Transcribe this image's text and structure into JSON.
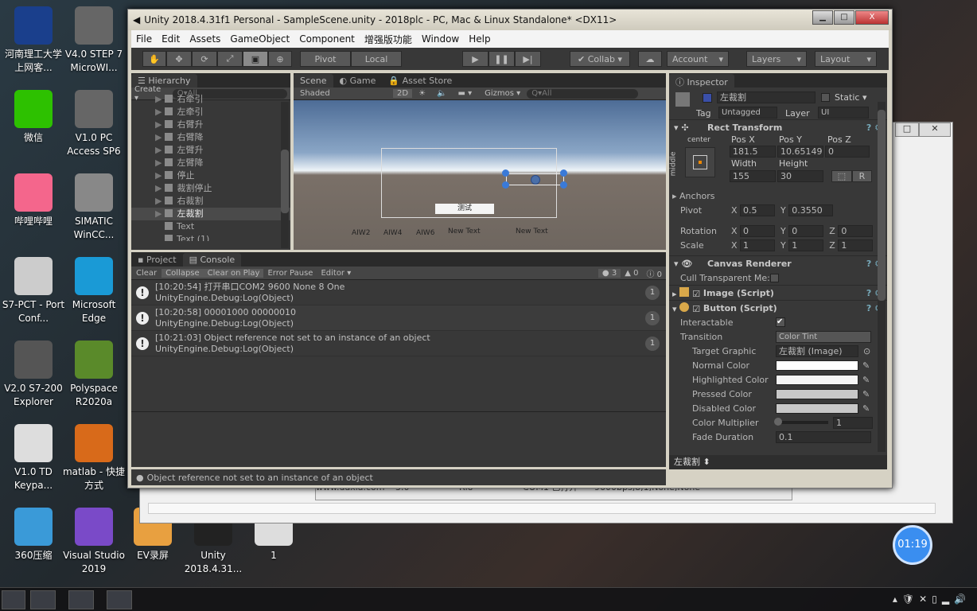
{
  "desktop": {
    "icons": [
      {
        "label": "河南理工大学上网客...",
        "color": "#1a3f8c"
      },
      {
        "label": "V4.0 STEP 7 MicroWI...",
        "color": "#666"
      },
      {
        "label": "微信",
        "color": "#2dc100"
      },
      {
        "label": "V1.0 PC Access SP6",
        "color": "#666"
      },
      {
        "label": "哔哩哔哩",
        "color": "#f4668c"
      },
      {
        "label": "SIMATIC WinCC...",
        "color": "#888"
      },
      {
        "label": "S7-PCT - Port Conf...",
        "color": "#ccc"
      },
      {
        "label": "Microsoft Edge",
        "color": "#1a9ad6"
      },
      {
        "label": "V2.0 S7-200 Explorer",
        "color": "#555"
      },
      {
        "label": "Polyspace R2020a",
        "color": "#5a8a2a"
      },
      {
        "label": "V1.0 TD Keypa...",
        "color": "#ddd"
      },
      {
        "label": "matlab - 快捷方式",
        "color": "#d86a1a"
      },
      {
        "label": "360压缩",
        "color": "#3a9ad8"
      },
      {
        "label": "Visual Studio 2019",
        "color": "#7a4ac8"
      },
      {
        "label": "EV录屏",
        "color": "#e8a040"
      },
      {
        "label": "Unity 2018.4.31...",
        "color": "#222"
      },
      {
        "label": "1",
        "color": "#ddd"
      }
    ]
  },
  "bg_window": {
    "cells": [
      "www.daxia.com",
      "3.0",
      "Rio",
      "COM1 已打开",
      "9600bps,8,1,None,None"
    ]
  },
  "timer": "01:19",
  "unity": {
    "title": "Unity 2018.4.31f1 Personal - SampleScene.unity - 2018plc - PC, Mac & Linux Standalone* <DX11>",
    "menu": [
      "File",
      "Edit",
      "Assets",
      "GameObject",
      "Component",
      "增强版功能",
      "Window",
      "Help"
    ],
    "toolbar": {
      "pivot": "Pivot",
      "local": "Local",
      "collab": "Collab",
      "account": "Account",
      "layers": "Layers",
      "layout": "Layout"
    },
    "hierarchy": {
      "tab": "Hierarchy",
      "create": "Create",
      "search": "Q▾All",
      "items": [
        {
          "label": "右牵引",
          "child": true
        },
        {
          "label": "左牵引",
          "child": true
        },
        {
          "label": "右臂升",
          "child": true
        },
        {
          "label": "右臂降",
          "child": true
        },
        {
          "label": "左臂升",
          "child": true
        },
        {
          "label": "左臂降",
          "child": true
        },
        {
          "label": "停止",
          "child": true
        },
        {
          "label": "裁割停止",
          "child": true
        },
        {
          "label": "右裁割",
          "child": true
        },
        {
          "label": "左裁割",
          "child": true,
          "selected": true
        },
        {
          "label": "Text",
          "child": false
        },
        {
          "label": "Text (1)",
          "child": false
        }
      ]
    },
    "scene": {
      "tabs": [
        "Scene",
        "Game",
        "Asset Store"
      ],
      "shading": "Shaded",
      "mode2d": "2D",
      "gizmos": "Gizmos",
      "search": "Q▾All",
      "button_text": "测试",
      "labels": [
        "AIW2",
        "AIW4",
        "AIW6",
        "New Text",
        "New Text"
      ]
    },
    "console": {
      "tabs": [
        "Project",
        "Console"
      ],
      "buttons": [
        "Clear",
        "Collapse",
        "Clear on Play",
        "Error Pause",
        "Editor"
      ],
      "counts": {
        "info": "3",
        "warn": "0",
        "error": "0"
      },
      "logs": [
        {
          "line1": "[10:20:54] 打开串口COM2 9600 None 8 One",
          "line2": "UnityEngine.Debug:Log(Object)",
          "count": "1"
        },
        {
          "line1": "[10:20:58] 00001000 00000010",
          "line2": "UnityEngine.Debug:Log(Object)",
          "count": "1"
        },
        {
          "line1": "[10:21:03] Object reference not set to an instance of an object",
          "line2": "UnityEngine.Debug:Log(Object)",
          "count": "1"
        }
      ]
    },
    "status": "Object reference not set to an instance of an object",
    "inspector": {
      "tab": "Inspector",
      "name": "左裁割",
      "static": "Static",
      "tag_label": "Tag",
      "tag": "Untagged",
      "layer_label": "Layer",
      "layer": "UI",
      "rect": {
        "title": "Rect Transform",
        "anchor_h": "center",
        "anchor_v": "middle",
        "posx_l": "Pos X",
        "posy_l": "Pos Y",
        "posz_l": "Pos Z",
        "posx": "181.5",
        "posy": "10.65149",
        "posz": "0",
        "w_l": "Width",
        "h_l": "Height",
        "w": "155",
        "h": "30",
        "r": "R",
        "anchors": "Anchors",
        "pivot": "Pivot",
        "pivot_x": "0.5",
        "pivot_y": "0.3550",
        "rotation": "Rotation",
        "rx": "0",
        "ry": "0",
        "rz": "0",
        "scale": "Scale",
        "sx": "1",
        "sy": "1",
        "sz": "1",
        "X": "X",
        "Y": "Y",
        "Z": "Z"
      },
      "canvas": {
        "title": "Canvas Renderer",
        "cull": "Cull Transparent Me:"
      },
      "image": {
        "title": "Image (Script)"
      },
      "button": {
        "title": "Button (Script)",
        "interactable": "Interactable",
        "transition": "Transition",
        "transition_val": "Color Tint",
        "target": "Target Graphic",
        "target_val": "左裁割 (Image)",
        "colors": [
          {
            "label": "Normal Color",
            "hex": "#ffffff"
          },
          {
            "label": "Highlighted Color",
            "hex": "#f5f5f5"
          },
          {
            "label": "Pressed Color",
            "hex": "#c8c8c8"
          },
          {
            "label": "Disabled Color",
            "hex": "#c8c8c8"
          }
        ],
        "multiplier": "Color Multiplier",
        "multiplier_val": "1",
        "fade": "Fade Duration",
        "fade_val": "0.1"
      },
      "footer": "左裁割"
    }
  }
}
